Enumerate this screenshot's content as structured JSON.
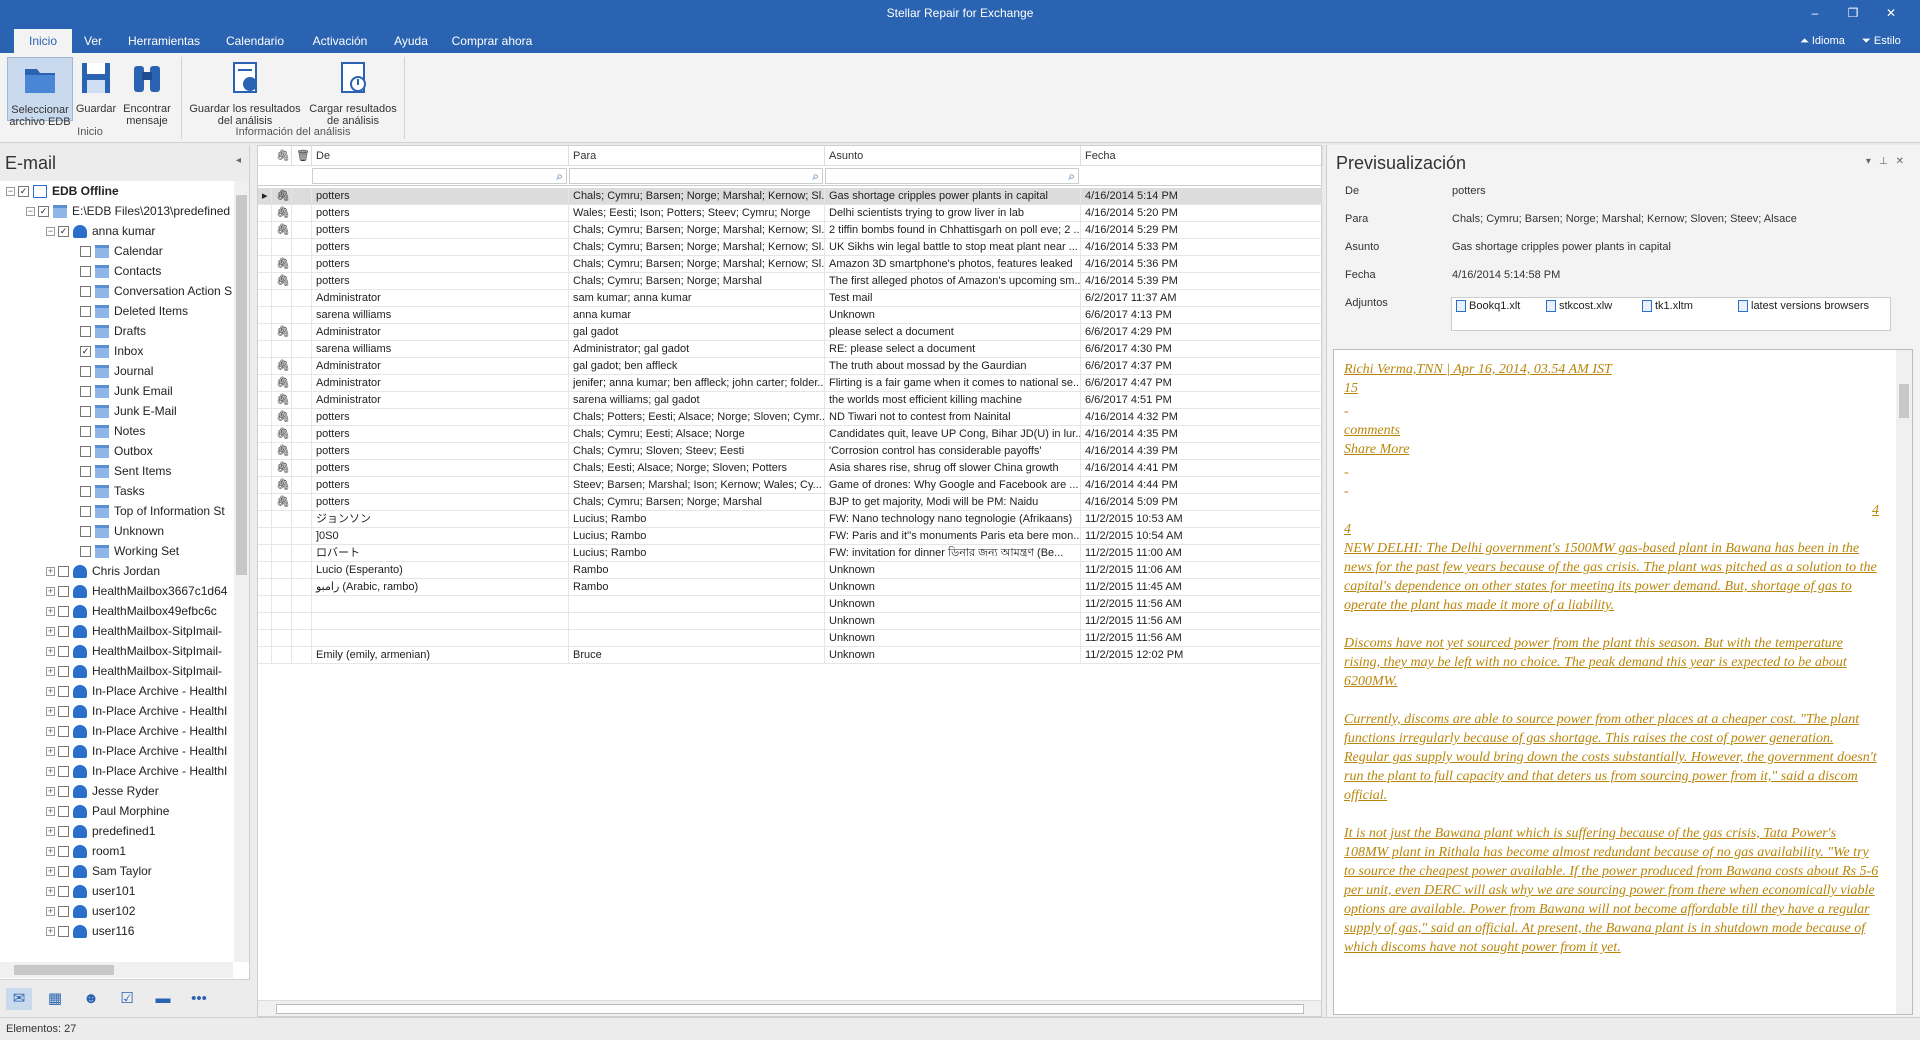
{
  "app": {
    "title": "Stellar Repair for Exchange"
  },
  "menu": {
    "tabs": [
      "Inicio",
      "Ver",
      "Herramientas",
      "Calendario",
      "Activación",
      "Ayuda",
      "Comprar ahora"
    ],
    "idioma": "Idioma",
    "estilo": "Estilo"
  },
  "ribbon": {
    "select_label": "Seleccionar archivo EDB",
    "save_label": "Guardar",
    "find_label": "Encontrar mensaje",
    "group_inicio": "Inicio",
    "save_scan_label": "Guardar los resultados del análisis",
    "load_scan_label": "Cargar resultados de análisis",
    "group_scan": "Información del análisis"
  },
  "left": {
    "title": "E-mail",
    "root": "EDB Offline",
    "file": "E:\\EDB Files\\2013\\predefined",
    "mailbox": "anna kumar",
    "folders": [
      "Calendar",
      "Contacts",
      "Conversation Action S",
      "Deleted Items",
      "Drafts",
      "Inbox",
      "Journal",
      "Junk Email",
      "Junk E-Mail",
      "Notes",
      "Outbox",
      "Sent Items",
      "Tasks",
      "Top of Information St",
      "Unknown",
      "Working Set"
    ],
    "mailboxes": [
      "Chris Jordan",
      "HealthMailbox3667c1d64",
      "HealthMailbox49efbc6c",
      "HealthMailbox-SitpImail-",
      "HealthMailbox-SitpImail-",
      "HealthMailbox-SitpImail-",
      "In-Place Archive - HealthI",
      "In-Place Archive - HealthI",
      "In-Place Archive - HealthI",
      "In-Place Archive - HealthI",
      "In-Place Archive - HealthI",
      "Jesse Ryder",
      "Paul Morphine",
      "predefined1",
      "room1",
      "Sam Taylor",
      "user101",
      "user102",
      "user116"
    ]
  },
  "grid": {
    "headers": {
      "from": "De",
      "to": "Para",
      "subject": "Asunto",
      "date": "Fecha"
    },
    "rows": [
      {
        "att": true,
        "from": "potters",
        "to": "Chals; Cymru; Barsen; Norge; Marshal; Kernow; Sl...",
        "subject": "Gas shortage cripples power plants in capital",
        "date": "4/16/2014 5:14 PM"
      },
      {
        "att": true,
        "from": "potters",
        "to": "Wales; Eesti; Ison; Potters; Steev; Cymru; Norge",
        "subject": "Delhi scientists trying to grow liver in lab",
        "date": "4/16/2014 5:20 PM"
      },
      {
        "att": true,
        "from": "potters",
        "to": "Chals; Cymru; Barsen; Norge; Marshal; Kernow; Sl...",
        "subject": "2 tiffin bombs found in Chhattisgarh on poll eve; 2 ...",
        "date": "4/16/2014 5:29 PM"
      },
      {
        "att": false,
        "from": "potters",
        "to": "Chals; Cymru; Barsen; Norge; Marshal; Kernow; Sl...",
        "subject": "UK Sikhs win legal battle to stop meat plant near ...",
        "date": "4/16/2014 5:33 PM"
      },
      {
        "att": true,
        "from": "potters",
        "to": "Chals; Cymru; Barsen; Norge; Marshal; Kernow; Sl...",
        "subject": "Amazon 3D smartphone's photos, features leaked",
        "date": "4/16/2014 5:36 PM"
      },
      {
        "att": true,
        "from": "potters",
        "to": "Chals; Cymru; Barsen; Norge; Marshal",
        "subject": "The first alleged photos of Amazon's upcoming sm...",
        "date": "4/16/2014 5:39 PM"
      },
      {
        "att": false,
        "from": "Administrator",
        "to": "sam kumar; anna kumar",
        "subject": "Test mail",
        "date": "6/2/2017 11:37 AM"
      },
      {
        "att": false,
        "from": "sarena williams",
        "to": "anna kumar",
        "subject": "Unknown",
        "date": "6/6/2017 4:13 PM"
      },
      {
        "att": true,
        "from": "Administrator",
        "to": "gal gadot",
        "subject": "please select a document",
        "date": "6/6/2017 4:29 PM"
      },
      {
        "att": false,
        "from": "sarena williams",
        "to": "Administrator; gal gadot",
        "subject": "RE: please select a document",
        "date": "6/6/2017 4:30 PM"
      },
      {
        "att": true,
        "from": "Administrator",
        "to": "gal gadot; ben affleck",
        "subject": "The truth about mossad by the Gaurdian",
        "date": "6/6/2017 4:37 PM"
      },
      {
        "att": true,
        "from": "Administrator",
        "to": "jenifer; anna kumar; ben affleck; john carter; folder...",
        "subject": "Flirting is a fair game when it comes to national se...",
        "date": "6/6/2017 4:47 PM"
      },
      {
        "att": true,
        "from": "Administrator",
        "to": "sarena williams; gal gadot",
        "subject": "the worlds most efficient killing machine",
        "date": "6/6/2017 4:51 PM"
      },
      {
        "att": true,
        "from": "potters",
        "to": "Chals; Potters; Eesti; Alsace; Norge; Sloven; Cymr...",
        "subject": "ND Tiwari not to contest from Nainital",
        "date": "4/16/2014 4:32 PM"
      },
      {
        "att": true,
        "from": "potters",
        "to": "Chals; Cymru; Eesti; Alsace; Norge",
        "subject": "Candidates quit, leave UP Cong, Bihar JD(U) in lur...",
        "date": "4/16/2014 4:35 PM"
      },
      {
        "att": true,
        "from": "potters",
        "to": "Chals; Cymru; Sloven; Steev; Eesti",
        "subject": "'Corrosion control has considerable payoffs'",
        "date": "4/16/2014 4:39 PM"
      },
      {
        "att": true,
        "from": "potters",
        "to": "Chals; Eesti; Alsace; Norge; Sloven; Potters",
        "subject": "Asia shares rise, shrug off slower China growth",
        "date": "4/16/2014 4:41 PM"
      },
      {
        "att": true,
        "from": "potters",
        "to": "Steev; Barsen; Marshal; Ison; Kernow; Wales; Cy...",
        "subject": "Game of drones: Why Google and Facebook are ...",
        "date": "4/16/2014 4:44 PM"
      },
      {
        "att": true,
        "from": "potters",
        "to": "Chals; Cymru; Barsen; Norge; Marshal",
        "subject": "BJP to get majority, Modi will be PM: Naidu",
        "date": "4/16/2014 5:09 PM"
      },
      {
        "att": false,
        "from": "ジョンソン",
        "to": "Lucius; Rambo",
        "subject": "FW: Nano technology  nano tegnologie (Afrikaans)",
        "date": "11/2/2015 10:53 AM"
      },
      {
        "att": false,
        "from": "]0S0",
        "to": "Lucius; Rambo",
        "subject": "FW: Paris and it''s monuments  Paris eta bere mon...",
        "date": "11/2/2015 10:54 AM"
      },
      {
        "att": false,
        "from": "ロバート",
        "to": "Lucius; Rambo",
        "subject": "FW: invitation for dinner  ডিনার জন্য আমন্ত্রণ (Be...",
        "date": "11/2/2015 11:00 AM"
      },
      {
        "att": false,
        "from": "Lucio (Esperanto)",
        "to": "Rambo",
        "subject": "Unknown",
        "date": "11/2/2015 11:06 AM"
      },
      {
        "att": false,
        "from": "رامبو (Arabic, rambo)",
        "to": "Rambo",
        "subject": "Unknown",
        "date": "11/2/2015 11:45 AM"
      },
      {
        "att": false,
        "from": "",
        "to": "",
        "subject": "Unknown",
        "date": "11/2/2015 11:56 AM"
      },
      {
        "att": false,
        "from": "",
        "to": "",
        "subject": "Unknown",
        "date": "11/2/2015 11:56 AM"
      },
      {
        "att": false,
        "from": "",
        "to": "",
        "subject": "Unknown",
        "date": "11/2/2015 11:56 AM"
      },
      {
        "att": false,
        "from": "Emily (emily, armenian)",
        "to": "Bruce",
        "subject": "Unknown",
        "date": "11/2/2015 12:02 PM"
      }
    ]
  },
  "preview": {
    "title": "Previsualización",
    "labels": {
      "from": "De",
      "to": "Para",
      "subject": "Asunto",
      "date": "Fecha",
      "attachments": "Adjuntos"
    },
    "from": "potters",
    "to": "Chals; Cymru; Barsen; Norge; Marshal; Kernow; Sloven; Steev; Alsace",
    "subject": "Gas shortage cripples power plants in capital",
    "date": "4/16/2014 5:14:58 PM",
    "attachments": [
      "Bookq1.xlt",
      "stkcost.xlw",
      "tk1.xltm",
      "latest versions browsers"
    ],
    "body": {
      "byline": "Richi Verma,TNN | Apr 16, 2014, 03.54 AM IST",
      "count": "15",
      "dash": "-",
      "comments": "comments",
      "share": "Share More",
      "num_right": "4",
      "num_left": "4",
      "p1": "NEW DELHI: The Delhi government's 1500MW gas-based plant in Bawana has been in the news for the past few years because of the gas crisis. The plant was pitched as a solution to the capital's dependence on other states for meeting its power demand. But, shortage of gas to operate the plant has made it more of a liability.",
      "p2": "Discoms have not yet sourced power from the plant this season. But with the temperature rising, they may be left with no choice. The peak demand this year is expected to be about 6200MW.",
      "p3": "Currently, discoms are able to source power from other places at a cheaper cost. \"The plant functions irregularly because of gas shortage. This raises the cost of power generation. Regular gas supply would bring down the costs substantially. However, the government doesn't run the plant to full capacity and that deters us from sourcing power from it,\" said a discom official.",
      "p4": "It is not just the Bawana plant which is suffering because of the gas crisis, Tata Power's 108MW plant in Rithala has become almost redundant because of no gas availability. \"We try to source the cheapest power available. If the power produced from Bawana costs about Rs 5-6 per unit, even DERC will ask why we are sourcing power from there when economically viable options are available. Power from Bawana will not become affordable till they have a regular supply of gas,\" said an official. At present, the Bawana plant is in shutdown mode because of which discoms have not sought power from it yet."
    }
  },
  "status": {
    "text": "Elementos: 27"
  },
  "colors": {
    "accent": "#2a63b1",
    "body_text": "#b8860b",
    "selected_row": "#dcdcdc"
  }
}
